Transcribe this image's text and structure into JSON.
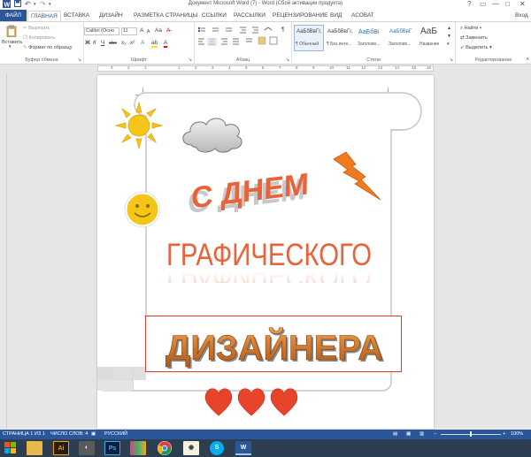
{
  "window": {
    "title": "Документ Microsoft Word (7) - Word (Сбой активации продукта)",
    "help": "?",
    "minimize": "—",
    "maximize": "□",
    "close": "✕"
  },
  "quick_access": {
    "save_icon": "save-icon",
    "undo_icon": "undo-icon",
    "redo_icon": "redo-icon"
  },
  "tabs": {
    "file": "ФАЙЛ",
    "items": [
      "ГЛАВНАЯ",
      "ВСТАВКА",
      "ДИЗАЙН",
      "РАЗМЕТКА СТРАНИЦЫ",
      "ССЫЛКИ",
      "РАССЫЛКИ",
      "РЕЦЕНЗИРОВАНИЕ",
      "ВИД",
      "АСОВАТ"
    ],
    "active": "ГЛАВНАЯ",
    "signin": "Вход"
  },
  "clipboard": {
    "paste": "Вставить",
    "cut": "Вырезать",
    "copy": "Копировать",
    "format_painter": "Формат по образцу",
    "label": "Буфер обмена"
  },
  "font": {
    "name": "Calibri (Осно",
    "size": "11",
    "label": "Шрифт",
    "bold": "Ж",
    "italic": "К",
    "underline": "Ч",
    "strike": "abc",
    "sub": "x₂",
    "sup": "x²",
    "grow": "A",
    "shrink": "A",
    "case": "Aa",
    "highlight": "ab",
    "color": "A"
  },
  "paragraph": {
    "label": "Абзац",
    "show_marks": "¶"
  },
  "styles": {
    "items": [
      {
        "sample": "АаБбВвГг,",
        "name": "¶ Обычный"
      },
      {
        "sample": "АаБбВвГг,",
        "name": "¶ Без инте..."
      },
      {
        "sample": "АаБбВі",
        "name": "Заголово..."
      },
      {
        "sample": "АаБбВвГ",
        "name": "Заголово..."
      },
      {
        "sample": "АаБ",
        "name": "Название"
      }
    ],
    "label": "Стили",
    "selected": "Обычный"
  },
  "editing": {
    "find": "Найти",
    "replace": "Заменить",
    "select": "Выделить",
    "label": "Редактирование"
  },
  "ruler": {
    "marks": [
      "3",
      "2",
      "1",
      "1",
      "2",
      "3",
      "4",
      "5",
      "6",
      "7",
      "8",
      "9",
      "10",
      "11",
      "12",
      "13",
      "14",
      "15",
      "16",
      "17"
    ]
  },
  "document": {
    "line1": "С ДНЕМ",
    "line2": "ГРАФИЧЕСКОГО",
    "line3": "ДИЗАЙНЕРА"
  },
  "status": {
    "page": "СТРАНИЦА 1 ИЗ 1",
    "words": "ЧИСЛО СЛОВ: 4",
    "language": "РУССКИЙ",
    "zoom": "100%"
  },
  "taskbar": {
    "items": [
      "file-explorer-icon",
      "illustrator-icon",
      "photoshop-icon",
      "media-icon",
      "chrome-icon",
      "eye-app-icon",
      "skype-icon",
      "word-icon"
    ],
    "ai": "Ai",
    "ps": "Ps",
    "s": "S",
    "w": "W"
  },
  "colors": {
    "accent": "#2b579a",
    "wordart_orange": "#e8623a",
    "frame_red": "#e03c2a",
    "heart_red": "#e8442c",
    "sun": "#f5c518"
  }
}
